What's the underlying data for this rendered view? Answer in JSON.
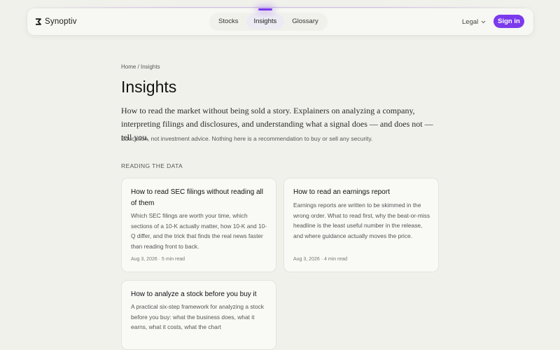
{
  "header": {
    "brand_name": "Synoptiv",
    "nav": [
      {
        "label": "Stocks"
      },
      {
        "label": "Insights",
        "active": true
      },
      {
        "label": "Glossary"
      }
    ],
    "legal_label": "Legal",
    "signin_label": "Sign in"
  },
  "page": {
    "breadcrumb": "Home / Insights",
    "title": "Insights",
    "lede": "How to read the market without being sold a story. Explainers on analyzing a company, interpreting filings and disclosures, and understanding what a signal does — and does not — tell you.",
    "disclaimer": "Education, not investment advice. Nothing here is a recommendation to buy or sell any security.",
    "section_label": "READING THE DATA"
  },
  "articles": [
    {
      "title": "How to read SEC filings without reading all of them",
      "description": "Which SEC filings are worth your time, which sections of a 10-K actually matter, how 10-K and 10-Q differ, and the trick that finds the real news faster than reading front to back.",
      "meta": "Aug 3, 2026 · 5 min read"
    },
    {
      "title": "How to read an earnings report",
      "description": "Earnings reports are written to be skimmed in the wrong order. What to read first, why the beat-or-miss headline is the least useful number in the release, and where guidance actually moves the price.",
      "meta": "Aug 3, 2026 · 4 min read"
    },
    {
      "title": "How to analyze a stock before you buy it",
      "description": "A practical six-step framework for analyzing a stock before you buy: what the business does, what it earns, what it costs, what the chart"
    }
  ],
  "colors": {
    "accent": "#7c3aed",
    "background": "#f1f1ec"
  },
  "icons": {
    "brand": "synoptiv-logo-icon",
    "legal_dropdown": "chevron-down-icon"
  }
}
